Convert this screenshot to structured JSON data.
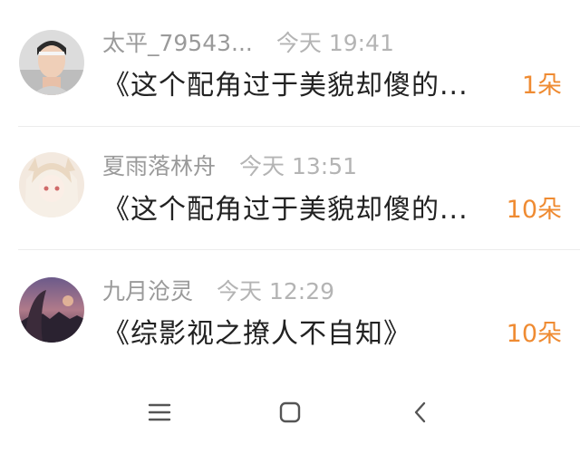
{
  "list": [
    {
      "username": "太平_79543...",
      "time": "今天 19:41",
      "book": "《这个配角过于美貌却傻的...",
      "count": "1朵"
    },
    {
      "username": "夏雨落林舟",
      "time": "今天 13:51",
      "book": "《这个配角过于美貌却傻的...",
      "count": "10朵"
    },
    {
      "username": "九月沧灵",
      "time": "今天 12:29",
      "book": "《综影视之撩人不自知》",
      "count": "10朵"
    }
  ],
  "navbar": {
    "menu_icon": "menu-icon",
    "home_icon": "home-icon",
    "back_icon": "back-icon"
  },
  "colors": {
    "accent": "#ef8b32",
    "username": "#9a9a9a",
    "time": "#b4b4b4",
    "title": "#222222",
    "nav": "#555555"
  }
}
